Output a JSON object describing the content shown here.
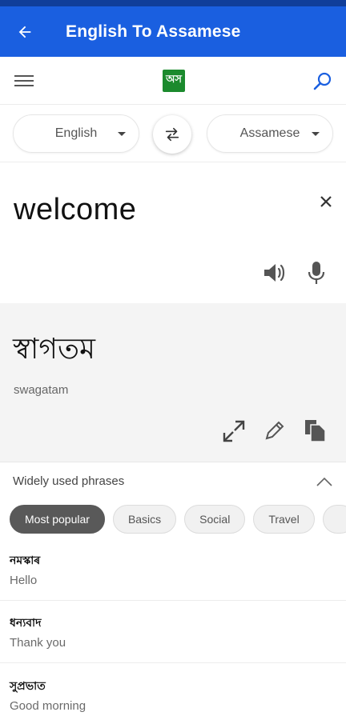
{
  "appbar": {
    "title": "English To Assamese"
  },
  "toolbar": {
    "logo_text": "অস"
  },
  "languages": {
    "source": "English",
    "target": "Assamese"
  },
  "input": {
    "text": "welcome"
  },
  "output": {
    "text": "স্বাগতম",
    "transliteration": "swagatam"
  },
  "phrases": {
    "header": "Widely used phrases",
    "chips": [
      "Most popular",
      "Basics",
      "Social",
      "Travel"
    ],
    "items": [
      {
        "assamese": "নমস্কাৰ",
        "english": "Hello"
      },
      {
        "assamese": "ধন্যবাদ",
        "english": "Thank you"
      },
      {
        "assamese": "সুপ্ৰভাত",
        "english": "Good morning"
      }
    ]
  },
  "colors": {
    "appbar": "#1a5fe0",
    "statusbar": "#103e9a",
    "logo": "#1b8a2d",
    "active_chip": "#595959"
  }
}
